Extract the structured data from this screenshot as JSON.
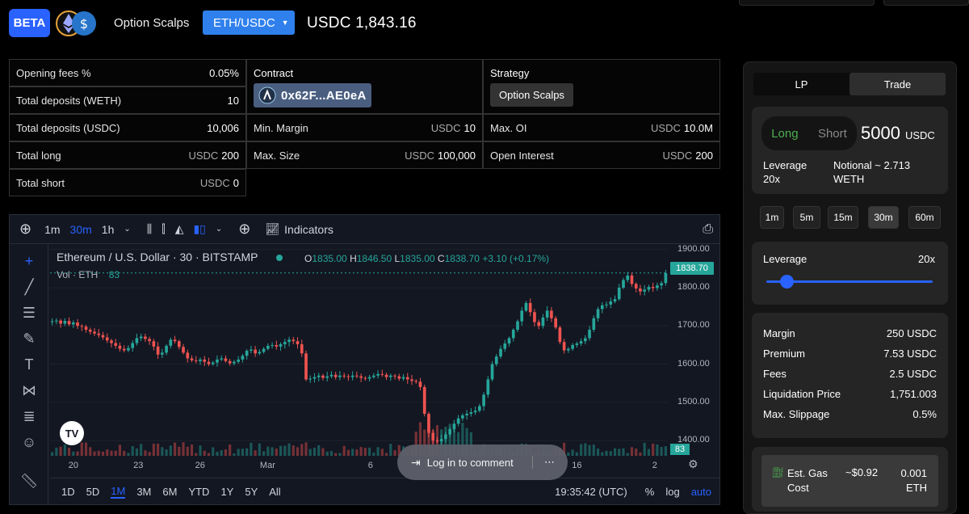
{
  "header": {
    "beta": "BETA",
    "app_name": "Option Scalps",
    "pair": "ETH/USDC",
    "price": "USDC 1,843.16"
  },
  "stats": {
    "col1": [
      {
        "label": "Opening fees %",
        "value": "0.05%"
      },
      {
        "label": "Total deposits (WETH)",
        "value": "10"
      },
      {
        "label": "Total deposits (USDC)",
        "value": "10,006"
      },
      {
        "label": "Total long",
        "unit": "USDC",
        "value": "200"
      },
      {
        "label": "Total short",
        "unit": "USDC",
        "value": "0"
      }
    ],
    "contract": {
      "label": "Contract",
      "address": "0x62F...AE0eA"
    },
    "strategy": {
      "label": "Strategy",
      "value": "Option Scalps"
    },
    "min_margin": {
      "label": "Min. Margin",
      "unit": "USDC",
      "value": "10"
    },
    "max_size": {
      "label": "Max. Size",
      "unit": "USDC",
      "value": "100,000"
    },
    "max_oi": {
      "label": "Max. OI",
      "unit": "USDC",
      "value": "10.0M"
    },
    "open_interest": {
      "label": "Open Interest",
      "unit": "USDC",
      "value": "200"
    }
  },
  "chart": {
    "toolbar": {
      "tf_1m": "1m",
      "tf_30m": "30m",
      "tf_1h": "1h",
      "indicators": "Indicators"
    },
    "legend": "Ethereum / U.S. Dollar · 30 · BITSTAMP",
    "ohlc": {
      "o_label": "O",
      "o": "1835.00",
      "h_label": "H",
      "h": "1846.50",
      "l_label": "L",
      "l": "1835.00",
      "c_label": "C",
      "c": "1838.70",
      "chg": "+3.10 (+0.17%)"
    },
    "vol_label": "Vol · ETH",
    "vol_value": "83",
    "last_price": "1838.70",
    "vol_badge": "83",
    "y_ticks": [
      "1900.00",
      "1800.00",
      "1700.00",
      "1600.00",
      "1500.00",
      "1400.00"
    ],
    "x_ticks": [
      "20",
      "23",
      "26",
      "Mar",
      "6",
      "16",
      "2"
    ],
    "ranges": [
      "1D",
      "5D",
      "1M",
      "3M",
      "6M",
      "YTD",
      "1Y",
      "5Y",
      "All"
    ],
    "time": "19:35:42 (UTC)",
    "pct": "%",
    "log": "log",
    "auto": "auto",
    "login": "Log in to comment",
    "series_close": [
      1712,
      1714,
      1706,
      1713,
      1704,
      1709,
      1700,
      1698,
      1690,
      1685,
      1680,
      1676,
      1670,
      1662,
      1655,
      1648,
      1640,
      1636,
      1642,
      1655,
      1668,
      1672,
      1666,
      1660,
      1646,
      1625,
      1630,
      1648,
      1664,
      1660,
      1645,
      1630,
      1615,
      1610,
      1608,
      1612,
      1606,
      1600,
      1604,
      1612,
      1615,
      1608,
      1602,
      1606,
      1612,
      1622,
      1635,
      1638,
      1628,
      1632,
      1640,
      1648,
      1650,
      1646,
      1652,
      1658,
      1664,
      1660,
      1652,
      1628,
      1560,
      1562,
      1566,
      1570,
      1564,
      1568,
      1572,
      1566,
      1570,
      1568,
      1566,
      1570,
      1568,
      1564,
      1562,
      1566,
      1570,
      1574,
      1572,
      1566,
      1570,
      1568,
      1562,
      1566,
      1560,
      1556,
      1554,
      1540,
      1470,
      1420,
      1400,
      1398,
      1404,
      1416,
      1430,
      1444,
      1458,
      1466,
      1470,
      1474,
      1478,
      1490,
      1520,
      1560,
      1600,
      1620,
      1640,
      1654,
      1668,
      1690,
      1712,
      1740,
      1760,
      1736,
      1710,
      1700,
      1722,
      1740,
      1720,
      1696,
      1658,
      1636,
      1640,
      1650,
      1654,
      1660,
      1668,
      1690,
      1720,
      1744,
      1754,
      1756,
      1764,
      1770,
      1800,
      1820,
      1832,
      1810,
      1798,
      1790,
      1795,
      1802,
      1799,
      1806,
      1812,
      1838
    ]
  },
  "panel": {
    "tabs": [
      "LP",
      "Trade"
    ],
    "long": "Long",
    "short": "Short",
    "amount": "5000",
    "amount_unit": "USDC",
    "leverage_label": "Leverage",
    "leverage_value": "20x",
    "notional_label": "Notional ~ 2.713",
    "notional_unit": "WETH",
    "timeframes": [
      "1m",
      "5m",
      "15m",
      "30m",
      "60m"
    ],
    "slider_label": "Leverage",
    "slider_value": "20x",
    "slider_level": 0.12,
    "summary": [
      {
        "label": "Margin",
        "value": "250 USDC"
      },
      {
        "label": "Premium",
        "value": "7.53 USDC"
      },
      {
        "label": "Fees",
        "value": "2.5 USDC"
      },
      {
        "label": "Liquidation Price",
        "value": "1,751.003"
      },
      {
        "label": "Max. Slippage",
        "value": "0.5%"
      }
    ],
    "gas_label": "Est. Gas",
    "gas_label2": "Cost",
    "gas_usd": "~$0.92",
    "gas_eth": "0.001",
    "gas_eth_unit": "ETH"
  }
}
